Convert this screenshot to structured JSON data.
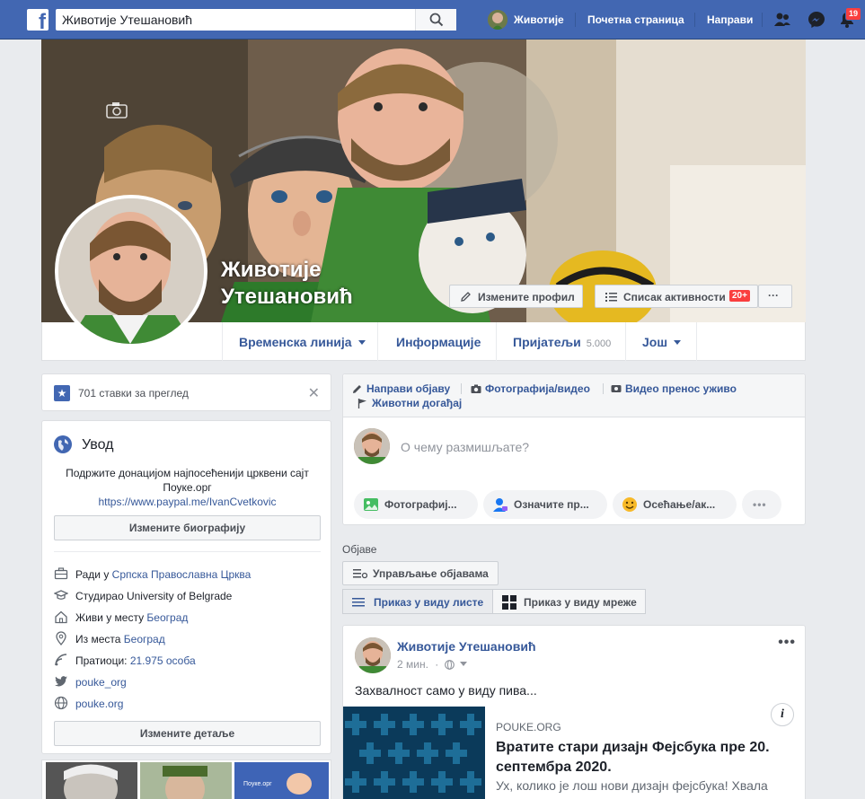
{
  "topbar": {
    "search_value": "Животије Утешановић",
    "user_name": "Животије",
    "home_label": "Почетна страница",
    "create_label": "Направи",
    "notifications_count": "19"
  },
  "profile": {
    "name_line1": "Животије",
    "name_line2": "Утешановић",
    "edit_profile_label": "Измените профил",
    "activity_log_label": "Списак активности",
    "activity_badge": "20+",
    "more_label": "···"
  },
  "tabs": {
    "timeline": "Временска линија",
    "about": "Информације",
    "friends": "Пријатељи",
    "friends_count": "5.000",
    "more": "Још"
  },
  "review": {
    "text": "701 ставки за преглед",
    "close": "✕"
  },
  "intro": {
    "title": "Увод",
    "bio_line1": "Подржите донацијом најпосећенији црквени сајт",
    "bio_line2": "Поуке.орг",
    "bio_link": "https://www.paypal.me/IvanCvetkovic",
    "edit_bio_label": "Измените биографију",
    "rows": [
      {
        "prefix": "Ради у ",
        "link": "Српска Православна Црква",
        "icon": "briefcase-icon"
      },
      {
        "prefix": "Студирао University of Belgrade",
        "link": "",
        "icon": "graduation-cap-icon"
      },
      {
        "prefix": "Живи у месту ",
        "link": "Београд",
        "icon": "home-icon"
      },
      {
        "prefix": "Из места ",
        "link": "Београд",
        "icon": "location-pin-icon"
      },
      {
        "prefix": "Пратиоци: ",
        "link": "21.975 особа",
        "icon": "followers-icon"
      },
      {
        "prefix": "",
        "link": "pouke_org",
        "icon": "twitter-icon"
      },
      {
        "prefix": "",
        "link": "pouke.org",
        "icon": "globe-icon"
      }
    ],
    "edit_details_label": "Измените детаље"
  },
  "composer": {
    "tab_create_post": "Направи објаву",
    "tab_photo_video": "Фотографија/видео",
    "tab_live_video": "Видео пренос уживо",
    "tab_life_event": "Животни догађај",
    "placeholder": "О чему размишљате?",
    "pill_photo": "Фотографиј...",
    "pill_tag": "Означите пр...",
    "pill_feeling": "Осећање/ак...",
    "pill_more": "•••"
  },
  "posts": {
    "section_label": "Објаве",
    "manage_label": "Управљање објавама",
    "list_view_label": "Приказ у виду листе",
    "grid_view_label": "Приказ у виду мреже"
  },
  "post": {
    "author": "Животије Утешановић",
    "time": "2 мин.",
    "text": "Захвалност само у виду пива...",
    "link_source": "POUKE.ORG",
    "link_title": "Вратите стари дизајн Фејсбука пре 20. септембра 2020.",
    "link_desc": "Ух, колико је лош нови дизајн фејсбука! Хвала",
    "dots": "•••"
  },
  "colors": {
    "brand": "#4267b2",
    "link": "#365899",
    "badge": "#fa3e3e"
  }
}
